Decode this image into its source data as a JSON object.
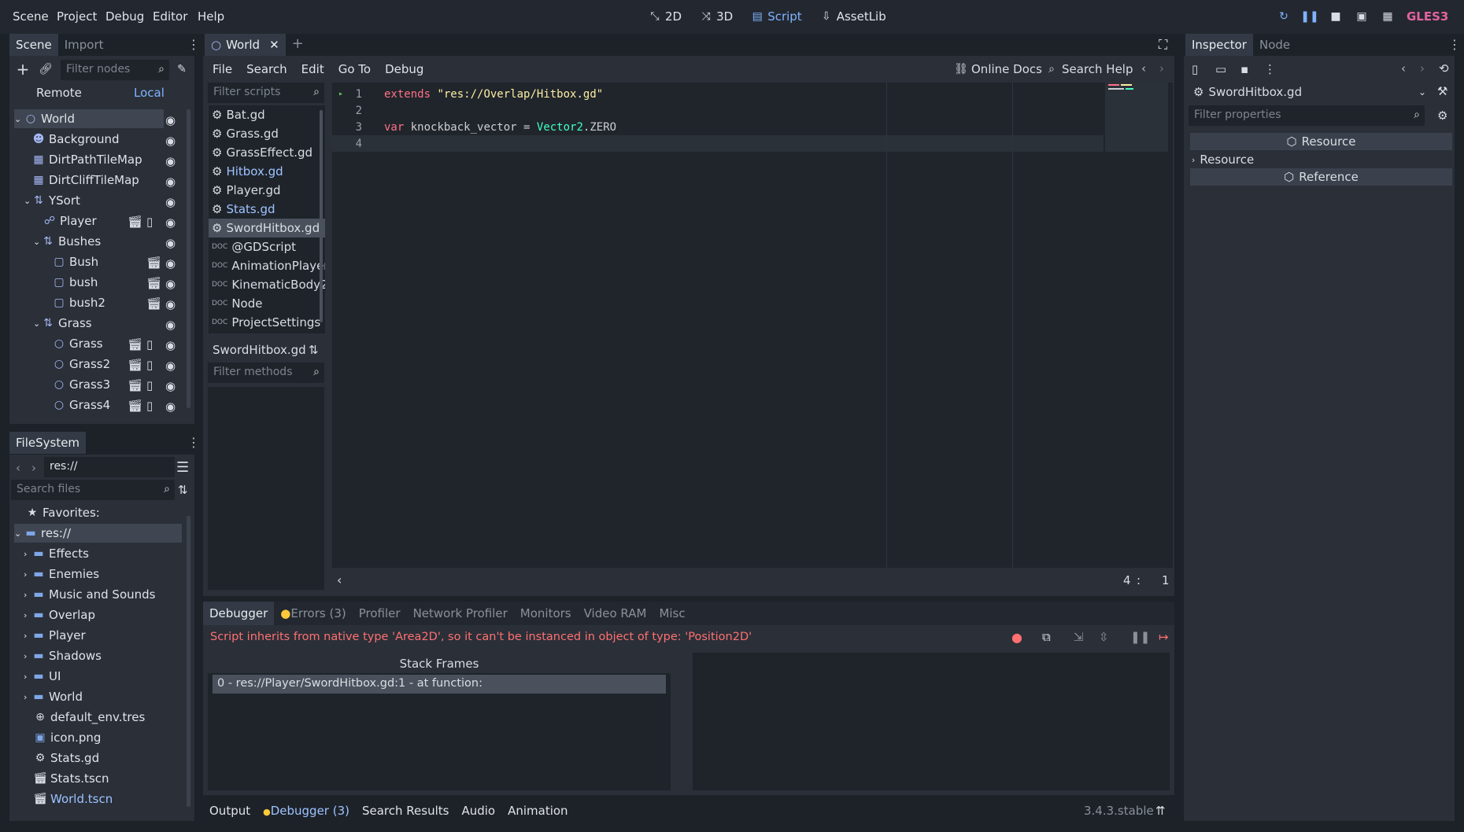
{
  "menu": [
    "Scene",
    "Project",
    "Debug",
    "Editor",
    "Help"
  ],
  "main_screens": [
    {
      "label": "2D",
      "icon": "2d-icon",
      "active": false
    },
    {
      "label": "3D",
      "icon": "3d-icon",
      "active": false
    },
    {
      "label": "Script",
      "icon": "script-icon",
      "active": true
    },
    {
      "label": "AssetLib",
      "icon": "assetlib-icon",
      "active": false
    }
  ],
  "renderer": "GLES3",
  "scene_dock": {
    "tabs": [
      "Scene",
      "Import"
    ],
    "filter_placeholder": "Filter nodes",
    "remote_label": "Remote",
    "local_label": "Local",
    "nodes": [
      {
        "label": "World",
        "icon": "node2d-icon",
        "selected": true
      },
      {
        "label": "Background",
        "icon": "sprite-icon"
      },
      {
        "label": "DirtPathTileMap",
        "icon": "tilemap-icon"
      },
      {
        "label": "DirtCliffTileMap",
        "icon": "tilemap-icon"
      },
      {
        "label": "YSort",
        "icon": "ysort-icon"
      },
      {
        "label": "Player",
        "icon": "kinematic-icon"
      },
      {
        "label": "Bushes",
        "icon": "ysort-icon"
      },
      {
        "label": "Bush",
        "icon": "staticbody-icon"
      },
      {
        "label": "bush",
        "icon": "staticbody-icon"
      },
      {
        "label": "bush2",
        "icon": "staticbody-icon"
      },
      {
        "label": "Grass",
        "icon": "ysort-icon"
      },
      {
        "label": "Grass",
        "icon": "node2d-icon"
      },
      {
        "label": "Grass2",
        "icon": "node2d-icon"
      },
      {
        "label": "Grass3",
        "icon": "node2d-icon"
      },
      {
        "label": "Grass4",
        "icon": "node2d-icon"
      }
    ]
  },
  "filesystem": {
    "tab": "FileSystem",
    "path": "res://",
    "search_placeholder": "Search files",
    "favorites_label": "Favorites:",
    "root_label": "res://",
    "folders": [
      "Effects",
      "Enemies",
      "Music and Sounds",
      "Overlap",
      "Player",
      "Shadows",
      "UI",
      "World"
    ],
    "files": [
      {
        "label": "default_env.tres",
        "icon": "environment-icon"
      },
      {
        "label": "icon.png",
        "icon": "image-icon"
      },
      {
        "label": "Stats.gd",
        "icon": "gear-icon"
      },
      {
        "label": "Stats.tscn",
        "icon": "scene-icon"
      },
      {
        "label": "World.tscn",
        "icon": "scene-icon"
      }
    ]
  },
  "editor": {
    "tab": "World",
    "script_menu": [
      "File",
      "Search",
      "Edit",
      "Go To",
      "Debug"
    ],
    "online_docs": "Online Docs",
    "search_help": "Search Help",
    "filter_scripts_placeholder": "Filter scripts",
    "scripts": [
      {
        "label": "Bat.gd",
        "icon": "gear-icon"
      },
      {
        "label": "Grass.gd",
        "icon": "gear-icon"
      },
      {
        "label": "GrassEffect.gd",
        "icon": "gear-icon"
      },
      {
        "label": "Hitbox.gd",
        "icon": "gear-icon"
      },
      {
        "label": "Player.gd",
        "icon": "gear-icon"
      },
      {
        "label": "Stats.gd",
        "icon": "gear-icon"
      },
      {
        "label": "SwordHitbox.gd",
        "icon": "gear-icon",
        "selected": true
      },
      {
        "label": "@GDScript",
        "icon": "doc-icon"
      },
      {
        "label": "AnimationPlayer",
        "icon": "doc-icon"
      },
      {
        "label": "KinematicBody2D",
        "icon": "doc-icon"
      },
      {
        "label": "Node",
        "icon": "doc-icon"
      },
      {
        "label": "ProjectSettings",
        "icon": "doc-icon"
      }
    ],
    "current_script": "SwordHitbox.gd",
    "filter_methods_placeholder": "Filter methods",
    "code": {
      "line1_kw": "extends",
      "line1_str": "\"res://Overlap/Hitbox.gd\"",
      "line3_kw": "var",
      "line3_ident": "knockback_vector",
      "line3_eq": " = ",
      "line3_type": "Vector2",
      "line3_const": ".ZERO",
      "line_numbers": [
        "1",
        "2",
        "3",
        "4"
      ]
    },
    "cursor_line": "4",
    "cursor_sep": ":",
    "cursor_col": "1"
  },
  "debugger": {
    "tabs": [
      "Debugger",
      "Errors (3)",
      "Profiler",
      "Network Profiler",
      "Monitors",
      "Video RAM",
      "Misc"
    ],
    "error_message": "Script inherits from native type 'Area2D', so it can't be instanced in object of type: 'Position2D'",
    "stack_frames_header": "Stack Frames",
    "stack_frame": "0 - res://Player/SwordHitbox.gd:1 - at function:"
  },
  "bottom_panel": {
    "tabs": [
      "Output",
      "Debugger (3)",
      "Search Results",
      "Audio",
      "Animation"
    ],
    "version": "3.4.3.stable"
  },
  "inspector": {
    "tabs": [
      "Inspector",
      "Node"
    ],
    "object": "SwordHitbox.gd",
    "filter_placeholder": "Filter properties",
    "section_resource": "Resource",
    "subsection_resource": "Resource",
    "section_reference": "Reference"
  },
  "colors": {
    "accent": "#7fb3ff",
    "error": "#ff7070",
    "warning_dot": "#ffca3a",
    "renderer": "#e5639f"
  }
}
